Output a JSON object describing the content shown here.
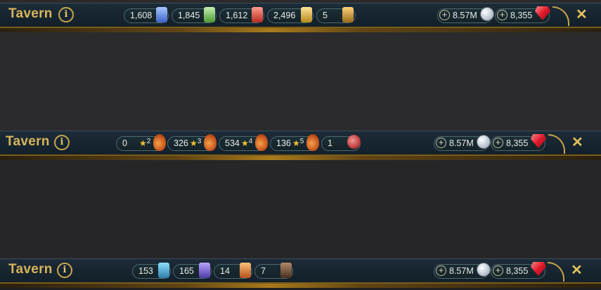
{
  "bars": [
    {
      "title": "Tavern",
      "resources": [
        {
          "value": "1,608",
          "icon": "blue-shard-icon"
        },
        {
          "value": "1,845",
          "icon": "green-shard-icon"
        },
        {
          "value": "1,612",
          "icon": "red-shard-icon"
        },
        {
          "value": "2,496",
          "icon": "gold-shard-icon"
        },
        {
          "value": "5",
          "icon": "potion-shard-icon"
        }
      ],
      "silver": "8.57M",
      "gems": "8,355"
    },
    {
      "title": "Tavern",
      "resources": [
        {
          "value": "0",
          "stars": "2",
          "icon": "chicken-icon"
        },
        {
          "value": "326",
          "stars": "3",
          "icon": "chicken-icon"
        },
        {
          "value": "534",
          "stars": "4",
          "icon": "chicken-icon"
        },
        {
          "value": "136",
          "stars": "5",
          "icon": "chicken-icon"
        },
        {
          "value": "1",
          "icon": "meat-icon"
        }
      ],
      "silver": "8.57M",
      "gems": "8,355"
    },
    {
      "title": "Tavern",
      "resources": [
        {
          "value": "153",
          "icon": "blue-book-icon"
        },
        {
          "value": "165",
          "icon": "purple-book-icon"
        },
        {
          "value": "14",
          "icon": "orange-book-icon"
        },
        {
          "value": "7",
          "icon": "dark-book-icon"
        }
      ],
      "silver": "8.57M",
      "gems": "8,355"
    }
  ],
  "info_glyph": "i",
  "plus_glyph": "+",
  "close_glyph": "✕",
  "colors": {
    "title": "#d8b55b",
    "accent_gold": "#c9a447",
    "bar_bg": "#16242f",
    "page_bg": "#2a2a2c"
  }
}
